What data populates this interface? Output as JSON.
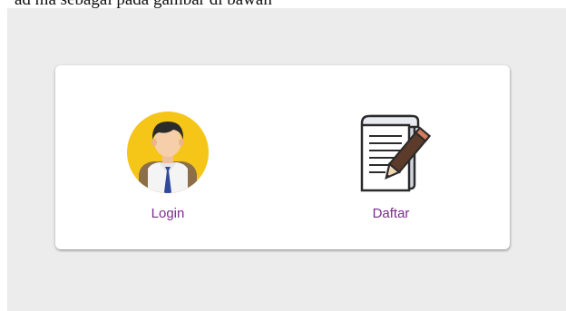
{
  "page": {
    "top_text": "ad    ma sebagai pada gambar di bawah"
  },
  "options": {
    "login": {
      "label": "Login",
      "icon": "student-avatar-icon"
    },
    "register": {
      "label": "Daftar",
      "icon": "document-pencil-icon"
    }
  },
  "colors": {
    "background": "#ececec",
    "card": "#ffffff",
    "label": "#7b2d8e",
    "avatar_circle": "#f5c518"
  }
}
